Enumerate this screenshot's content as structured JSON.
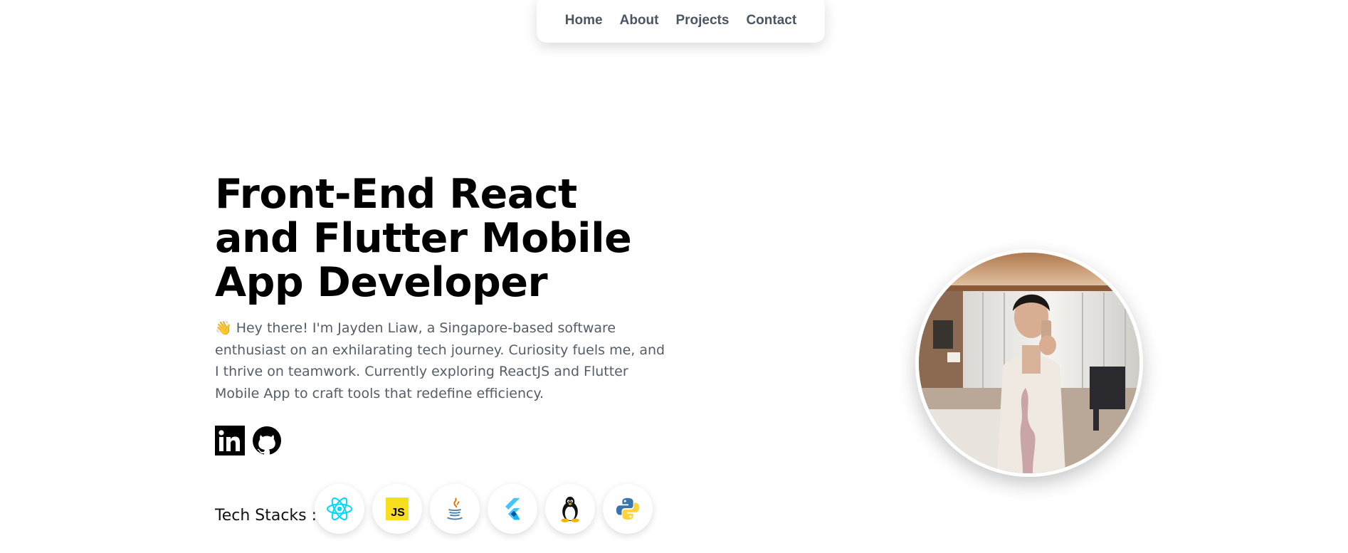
{
  "nav": {
    "items": [
      {
        "label": "Home"
      },
      {
        "label": "About"
      },
      {
        "label": "Projects"
      },
      {
        "label": "Contact"
      }
    ]
  },
  "hero": {
    "title": "Front-End React and Flutter Mobile App Developer",
    "intro": "👋 Hey there! I'm Jayden Liaw, a Singapore-based software enthusiast on an exhilarating tech journey. Curiosity fuels me, and I thrive on teamwork. Currently exploring ReactJS and Flutter Mobile App to craft tools that redefine efficiency."
  },
  "socials": [
    {
      "icon": "linkedin-icon"
    },
    {
      "icon": "github-icon"
    }
  ],
  "tech_stacks": {
    "label": "Tech Stacks :",
    "items": [
      {
        "icon": "react-icon",
        "color": "#00d8ff"
      },
      {
        "icon": "javascript-icon",
        "color": "#f7df1e",
        "text": "JS"
      },
      {
        "icon": "java-icon",
        "color": "#e76f00"
      },
      {
        "icon": "flutter-icon",
        "color": "#42a5f5"
      },
      {
        "icon": "linux-icon",
        "color": "#000000"
      },
      {
        "icon": "python-icon",
        "color": "#3776ab"
      }
    ]
  },
  "portrait": {
    "icon": "profile-photo"
  }
}
